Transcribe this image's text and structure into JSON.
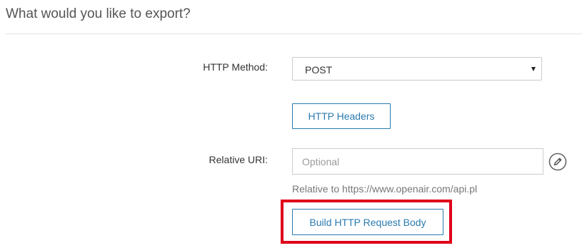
{
  "section": {
    "heading": "What would you like to export?"
  },
  "form": {
    "http_method": {
      "label": "HTTP Method:",
      "selected": "POST",
      "icon": "caret-down-icon"
    },
    "headers_button": {
      "label": "HTTP Headers"
    },
    "relative_uri": {
      "label": "Relative URI:",
      "value": "",
      "placeholder": "Optional",
      "edit_icon": "pencil-icon",
      "helper": "Relative to https://www.openair.com/api.pl"
    },
    "body_button": {
      "label": "Build HTTP Request Body"
    }
  },
  "colors": {
    "accent": "#2a7ab0",
    "highlight": "#e0001b"
  }
}
